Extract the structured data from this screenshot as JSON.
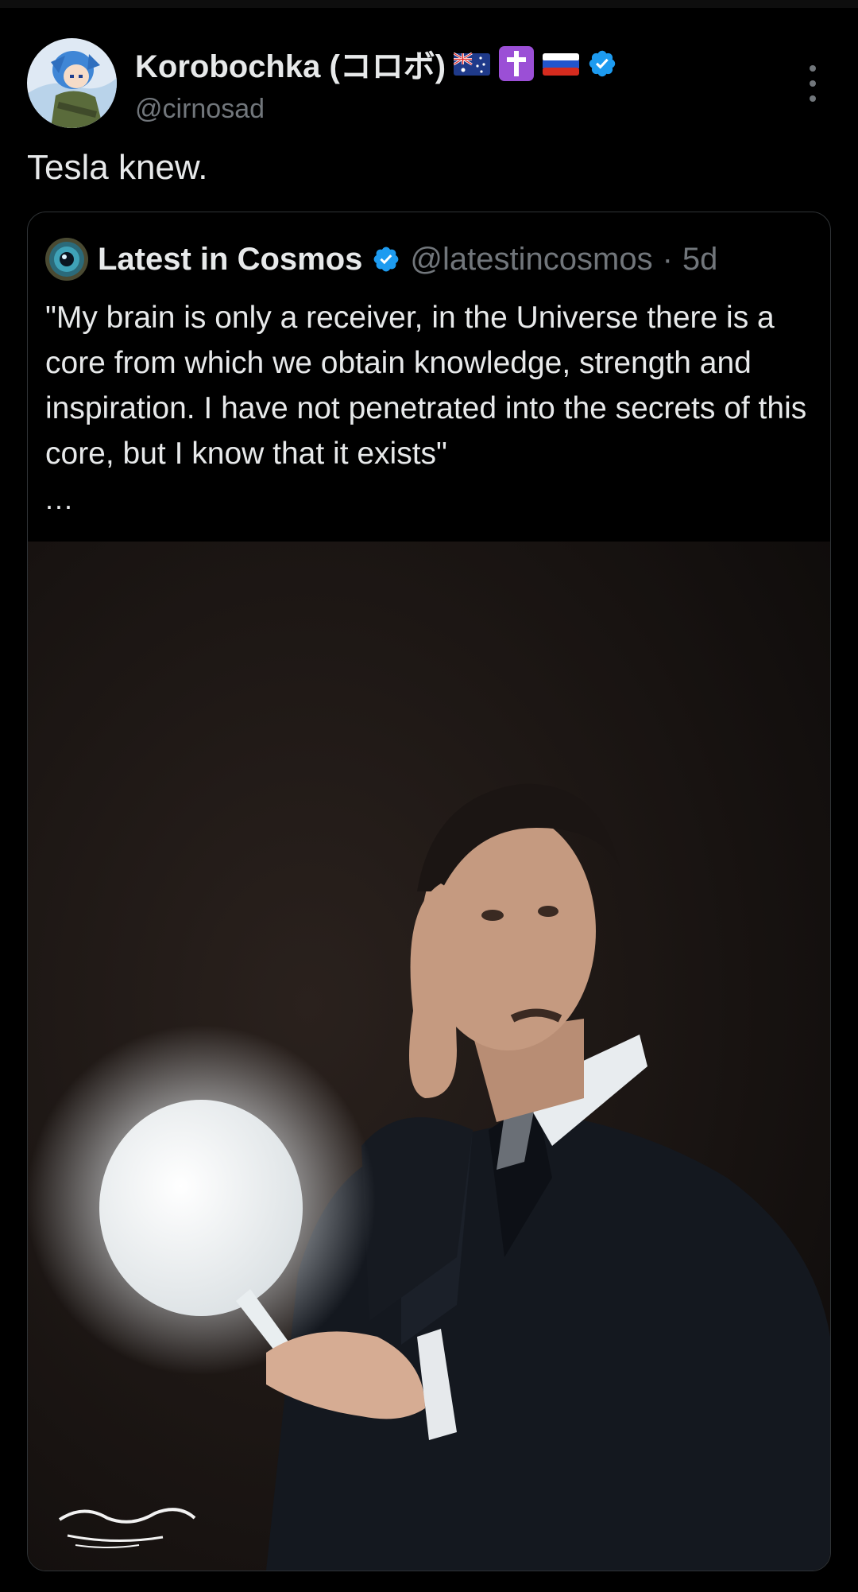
{
  "post": {
    "author_name": "Korobochka (コロボ)",
    "author_handle": "@cirnosad",
    "text": "Tesla knew."
  },
  "quoted": {
    "author_name": "Latest in Cosmos",
    "author_handle": "@latestincosmos",
    "separator": "·",
    "time": "5d",
    "text": "\"My brain is only a receiver, in the Universe there is a core from which we obtain knowledge, strength and inspiration. I have not penetrated into the secrets of this core, but I know that it exists\"",
    "ellipsis": "...",
    "signature": "Lorenzo Folli"
  },
  "colors": {
    "background": "#000000",
    "text": "#e7e9ea",
    "muted": "#71767b",
    "verified": "#1d9bf0",
    "border": "#2f3336"
  }
}
